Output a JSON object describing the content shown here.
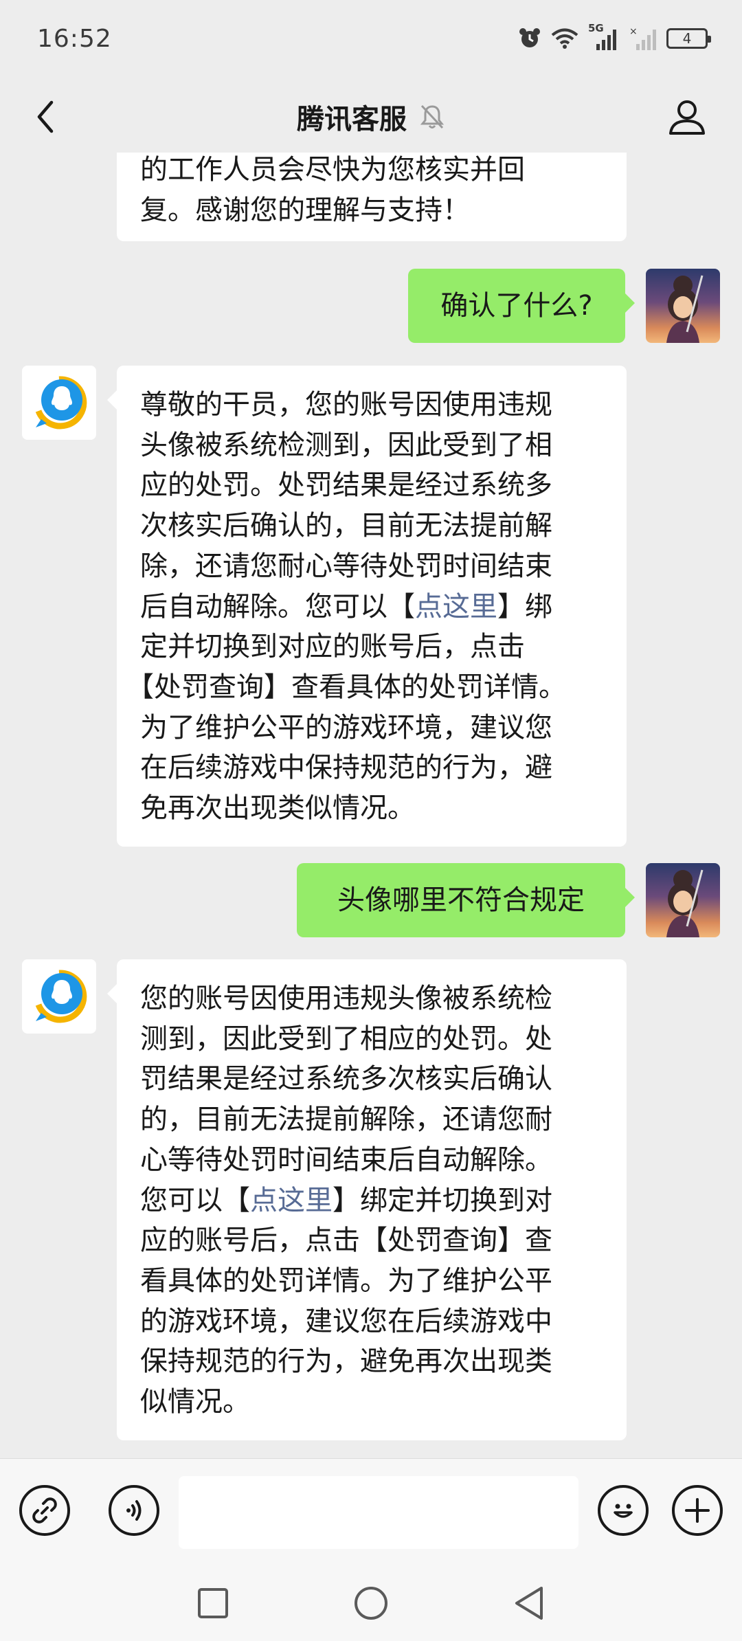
{
  "status_bar": {
    "time": "16:52",
    "network_label": "5G",
    "battery_level": "4"
  },
  "header": {
    "title": "腾讯客服",
    "mute_icon": "bell-slash-icon",
    "back_icon": "chevron-left-icon",
    "profile_icon": "person-icon"
  },
  "messages": [
    {
      "sender": "service",
      "lines": [
        "的工作人员会尽快为您核实并回",
        "复。感谢您的理解与支持！"
      ]
    },
    {
      "sender": "user",
      "text": "确认了什么?"
    },
    {
      "sender": "service",
      "lines": [
        "尊敬的干员，您的账号因使用违规",
        "头像被系统检测到，因此受到了相",
        "应的处罚。处罚结果是经过系统多",
        "次核实后确认的，目前无法提前解",
        "除，还请您耐心等待处罚时间结束"
      ],
      "line6_before": "后自动解除。您可以【",
      "line6_link": "点这里",
      "line6_after": "】绑",
      "lines_after": [
        "定并切换到对应的账号后，点击",
        "【处罚查询】查看具体的处罚详情。",
        "为了维护公平的游戏环境，建议您",
        "在后续游戏中保持规范的行为，避",
        "免再次出现类似情况。"
      ]
    },
    {
      "sender": "user",
      "text": "头像哪里不符合规定"
    },
    {
      "sender": "service",
      "lines": [
        "您的账号因使用违规头像被系统检",
        "测到，因此受到了相应的处罚。处",
        "罚结果是经过系统多次核实后确认",
        "的，目前无法提前解除，还请您耐",
        "心等待处罚时间结束后自动解除。"
      ],
      "line6_before": "您可以【",
      "line6_link": "点这里",
      "line6_after": "】绑定并切换到对",
      "lines_after": [
        "应的账号后，点击【处罚查询】查",
        "看具体的处罚详情。为了维护公平",
        "的游戏环境，建议您在后续游戏中",
        "保持规范的行为，避免再次出现类",
        "似情况。"
      ]
    }
  ],
  "input_bar": {
    "left_icons": [
      "link-icon",
      "voice-icon"
    ],
    "right_icons": [
      "emoji-icon",
      "plus-icon"
    ],
    "placeholder": ""
  },
  "nav_bar": {
    "icons": [
      "square-icon",
      "circle-icon",
      "back-triangle-icon"
    ]
  },
  "colors": {
    "background": "#ededed",
    "outgoing_bubble": "#95ec69",
    "incoming_bubble": "#ffffff",
    "link": "#576b95",
    "service_logo_blue": "#1e96e6",
    "service_logo_yellow": "#f5b400"
  }
}
